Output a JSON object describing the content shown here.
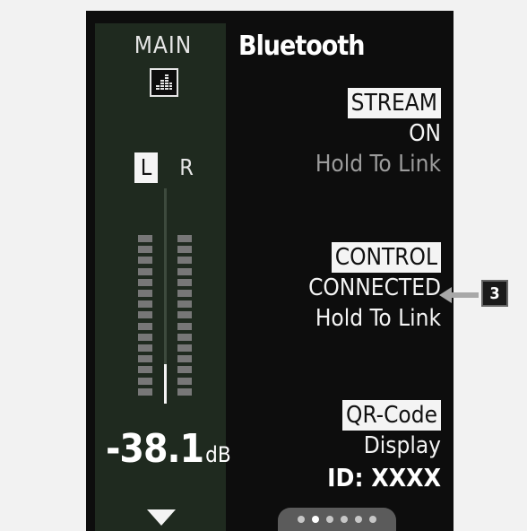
{
  "left_panel": {
    "main_label": "MAIN",
    "left_channel": "L",
    "right_channel": "R",
    "meter_level_fraction": 0.18,
    "db_value": "-38.1",
    "db_unit": "dB"
  },
  "header": {
    "title": "Bluetooth"
  },
  "stream": {
    "tag": "STREAM",
    "status": "ON",
    "action": "Hold To Link"
  },
  "control": {
    "tag": "CONTROL",
    "status": "CONNECTED",
    "action": "Hold To Link"
  },
  "qr": {
    "tag": "QR-Code",
    "action": "Display",
    "id_text": "ID:  XXXX"
  },
  "callout": {
    "number": "3"
  },
  "pagination": {
    "count": 6,
    "active_index": 1
  },
  "colors": {
    "panel_bg": "#0d0d0d",
    "left_panel_bg": "#1f2a1f",
    "page_bg": "#f2f2f2"
  }
}
